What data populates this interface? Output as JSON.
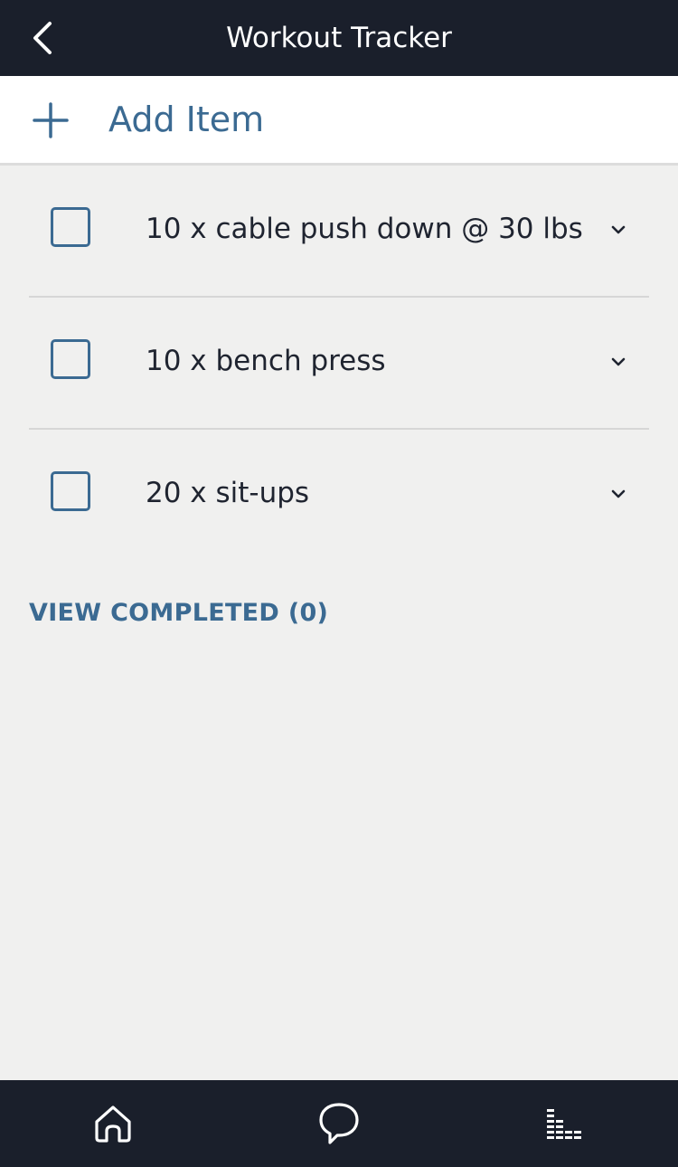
{
  "header": {
    "title": "Workout Tracker",
    "back_icon": "chevron-left-icon"
  },
  "add_item": {
    "label": "Add Item",
    "icon": "plus-icon"
  },
  "items": [
    {
      "text": "10 x cable push down @ 30 lbs",
      "checked": false
    },
    {
      "text": "10 x bench press",
      "checked": false
    },
    {
      "text": "20 x sit-ups",
      "checked": false
    }
  ],
  "view_completed": {
    "label": "VIEW COMPLETED (0)"
  },
  "bottom_nav": {
    "items": [
      {
        "icon": "home-icon"
      },
      {
        "icon": "chat-bubble-icon"
      },
      {
        "icon": "activity-bars-icon"
      }
    ]
  },
  "colors": {
    "header_bg": "#1a1f2b",
    "accent": "#3b6a92",
    "background": "#f0f0ef",
    "text": "#1f2430"
  }
}
